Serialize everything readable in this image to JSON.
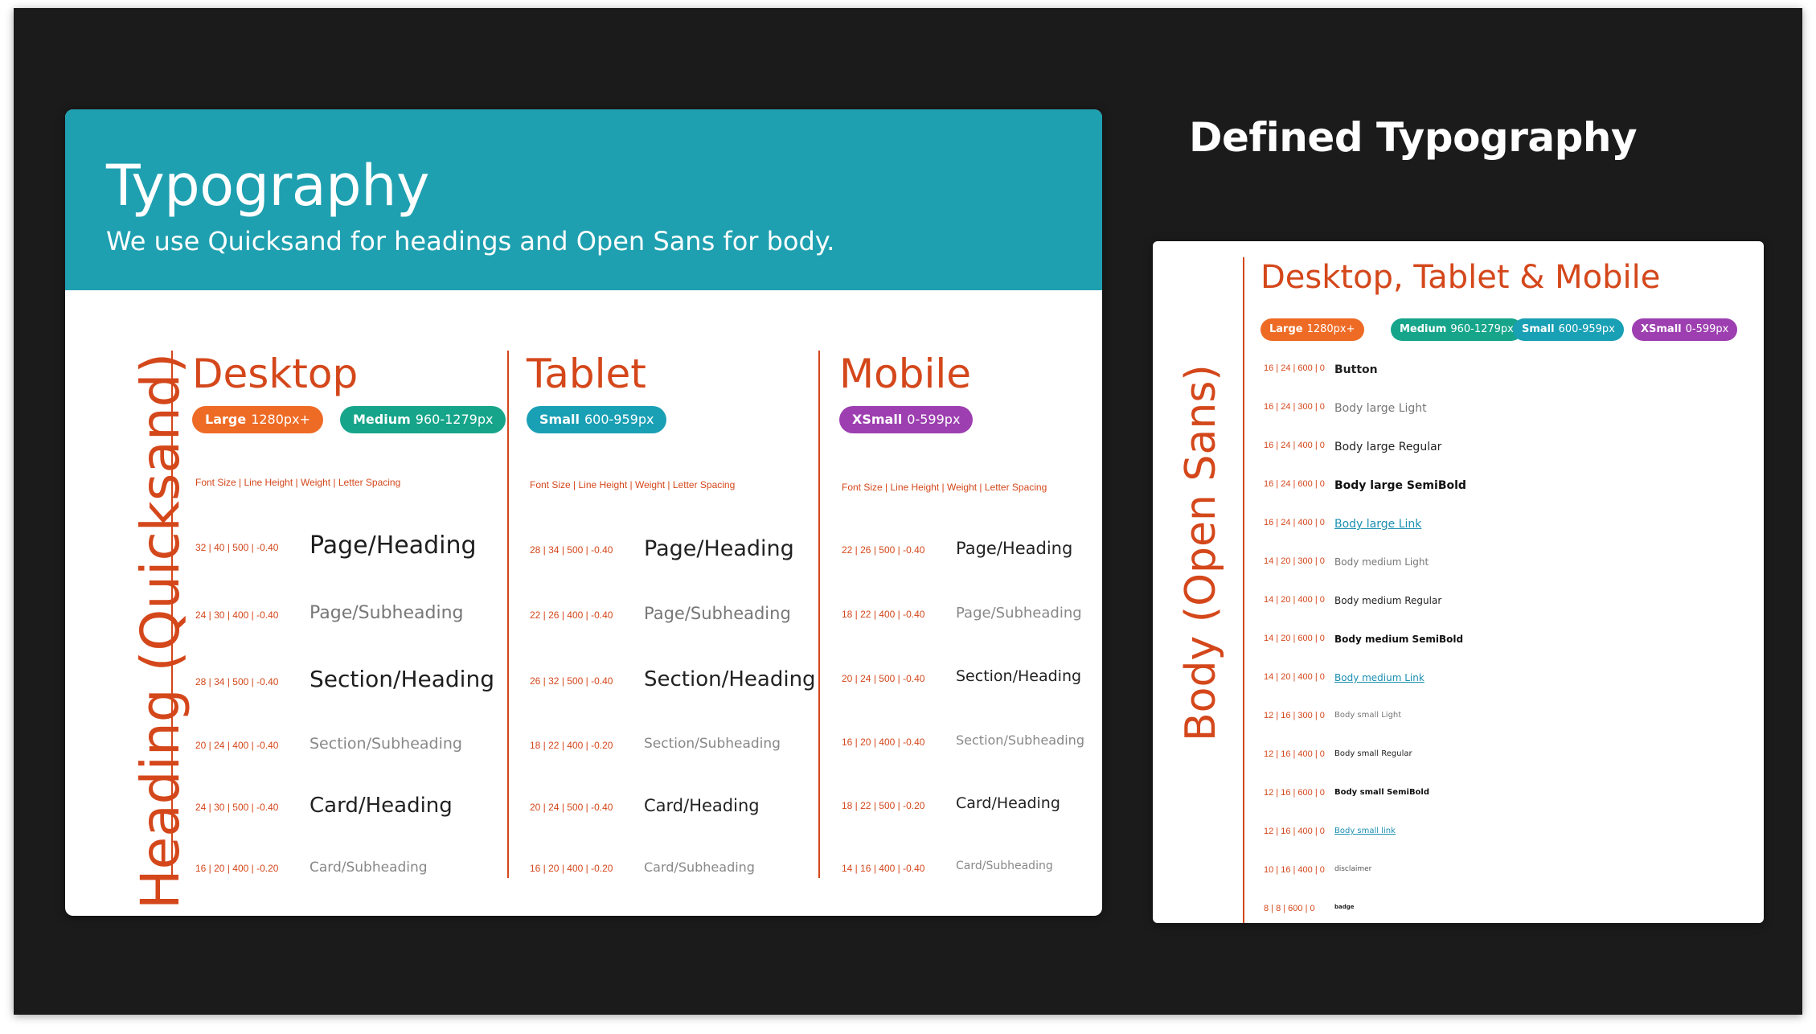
{
  "slide_title": "Defined Typography",
  "left_card": {
    "title": "Typography",
    "subtitle": "We use Quicksand for headings and Open Sans for body.",
    "vertical_label": "Heading (Quicksand)",
    "columns": [
      {
        "title": "Desktop",
        "pills": [
          {
            "bold": "Large",
            "range": "1280px+",
            "color": "#ee6b25"
          },
          {
            "bold": "Medium",
            "range": "960-1279px",
            "color": "#16a58a"
          }
        ],
        "legend": "Font Size | Line Height | Weight | Letter Spacing",
        "rows": [
          {
            "specs": "32 | 40 | 500 | -0.40",
            "sample": "Page/Heading"
          },
          {
            "specs": "24 | 30 | 400 | -0.40",
            "sample": "Page/Subheading"
          },
          {
            "specs": "28 | 34 | 500 | -0.40",
            "sample": "Section/Heading"
          },
          {
            "specs": "20 | 24 | 400 | -0.40",
            "sample": "Section/Subheading"
          },
          {
            "specs": "24 | 30 | 500 | -0.40",
            "sample": "Card/Heading"
          },
          {
            "specs": "16 | 20 | 400 | -0.20",
            "sample": "Card/Subheading"
          }
        ]
      },
      {
        "title": "Tablet",
        "pills": [
          {
            "bold": "Small",
            "range": "600-959px",
            "color": "#1aa0b5"
          }
        ],
        "legend": "Font Size | Line Height | Weight | Letter Spacing",
        "rows": [
          {
            "specs": "28 | 34 | 500 | -0.40",
            "sample": "Page/Heading"
          },
          {
            "specs": "22 | 26 | 400 | -0.40",
            "sample": "Page/Subheading"
          },
          {
            "specs": "26 | 32 | 500 | -0.40",
            "sample": "Section/Heading"
          },
          {
            "specs": "18 | 22 | 400 | -0.20",
            "sample": "Section/Subheading"
          },
          {
            "specs": "20 | 24 | 500 | -0.40",
            "sample": "Card/Heading"
          },
          {
            "specs": "16 | 20 | 400 | -0.20",
            "sample": "Card/Subheading"
          }
        ]
      },
      {
        "title": "Mobile",
        "pills": [
          {
            "bold": "XSmall",
            "range": "0-599px",
            "color": "#9d3fb0"
          }
        ],
        "legend": "Font Size | Line Height | Weight | Letter Spacing",
        "rows": [
          {
            "specs": "22 | 26 | 500 | -0.40",
            "sample": "Page/Heading"
          },
          {
            "specs": "18 | 22 | 400 | -0.40",
            "sample": "Page/Subheading"
          },
          {
            "specs": "20 | 24 | 500 | -0.40",
            "sample": "Section/Heading"
          },
          {
            "specs": "16 | 20 | 400 | -0.40",
            "sample": "Section/Subheading"
          },
          {
            "specs": "18 | 22 | 500 | -0.20",
            "sample": "Card/Heading"
          },
          {
            "specs": "14 | 16 | 400 | -0.40",
            "sample": "Card/Subheading"
          }
        ]
      }
    ]
  },
  "right_card": {
    "title": "Desktop, Tablet & Mobile",
    "vertical_label": "Body (Open Sans)",
    "pills": [
      {
        "bold": "Large",
        "range": "1280px+",
        "color": "#ee6b25"
      },
      {
        "bold": "Medium",
        "range": "960-1279px",
        "color": "#16a58a"
      },
      {
        "bold": "Small",
        "range": "600-959px",
        "color": "#1aa0b5"
      },
      {
        "bold": "XSmall",
        "range": "0-599px",
        "color": "#9d3fb0"
      }
    ],
    "rows": [
      {
        "specs": "16 | 24 | 600 | 0",
        "sample": "Button"
      },
      {
        "specs": "16 | 24 | 300 | 0",
        "sample": "Body large Light"
      },
      {
        "specs": "16 | 24 | 400 | 0",
        "sample": "Body large Regular"
      },
      {
        "specs": "16 | 24 | 600 | 0",
        "sample": "Body large SemiBold"
      },
      {
        "specs": "16 | 24 | 400 | 0",
        "sample": "Body large Link"
      },
      {
        "specs": "14 | 20 | 300 | 0",
        "sample": "Body medium Light"
      },
      {
        "specs": "14 | 20 | 400 | 0",
        "sample": "Body medium Regular"
      },
      {
        "specs": "14 | 20 | 600 | 0",
        "sample": "Body medium SemiBold"
      },
      {
        "specs": "14 | 20 | 400 | 0",
        "sample": "Body medium Link"
      },
      {
        "specs": "12 | 16 | 300 | 0",
        "sample": "Body small Light"
      },
      {
        "specs": "12 | 16 | 400 | 0",
        "sample": "Body small Regular"
      },
      {
        "specs": "12 | 16 | 600 | 0",
        "sample": "Body small SemiBold"
      },
      {
        "specs": "12 | 16 | 400 | 0",
        "sample": "Body small link"
      },
      {
        "specs": "10 | 16 | 400 | 0",
        "sample": "disclaimer"
      },
      {
        "specs": "8 | 8 | 600 | 0",
        "sample": "badge"
      }
    ]
  }
}
